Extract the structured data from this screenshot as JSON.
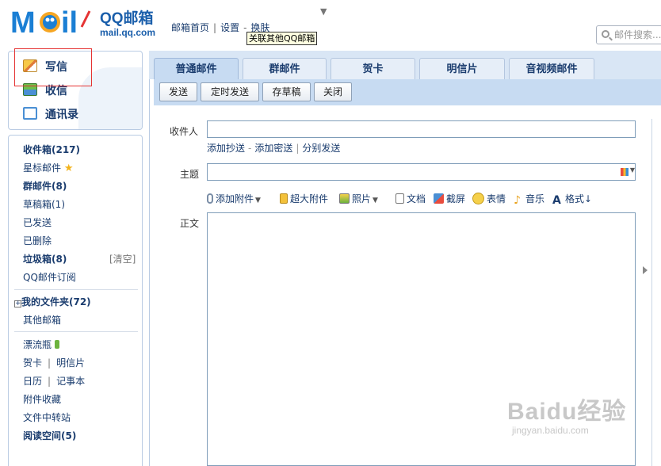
{
  "header": {
    "logo_title": "QQ邮箱",
    "logo_domain": "mail.qq.com",
    "nav": [
      "邮箱首页",
      "设置",
      "换肤"
    ],
    "tooltip": "关联其他QQ邮箱",
    "search_placeholder": "邮件搜索..."
  },
  "quick": {
    "write": "写信",
    "inbox": "收信",
    "contacts": "通讯录"
  },
  "folders": {
    "inbox": "收件箱(217)",
    "starred": "星标邮件",
    "group": "群邮件(8)",
    "drafts": "草稿箱(1)",
    "sent": "已发送",
    "deleted": "已删除",
    "spam": "垃圾箱(8)",
    "clear": "[清空]",
    "subscribe": "QQ邮件订阅",
    "my_folders": "我的文件夹(72)",
    "other_mail": "其他邮箱",
    "bottle": "漂流瓶",
    "card": "贺卡",
    "postcard": "明信片",
    "calendar": "日历",
    "notes": "记事本",
    "attach_fav": "附件收藏",
    "file_transfer": "文件中转站",
    "reading": "阅读空间(5)"
  },
  "tabs": [
    "普通邮件",
    "群邮件",
    "贺卡",
    "明信片",
    "音视频邮件"
  ],
  "toolbar": {
    "send": "发送",
    "timed_send": "定时发送",
    "save_draft": "存草稿",
    "close": "关闭"
  },
  "compose": {
    "to_label": "收件人",
    "cc_link": "添加抄送",
    "bcc_link": "添加密送",
    "separate_link": "分别发送",
    "subject_label": "主题",
    "body_label": "正文",
    "attach": "添加附件",
    "big_attach": "超大附件",
    "photo": "照片",
    "doc": "文档",
    "screenshot": "截屏",
    "emoji": "表情",
    "music": "音乐",
    "format": "格式↓"
  },
  "watermark": {
    "brand": "Baidu经验",
    "url": "jingyan.baidu.com"
  }
}
